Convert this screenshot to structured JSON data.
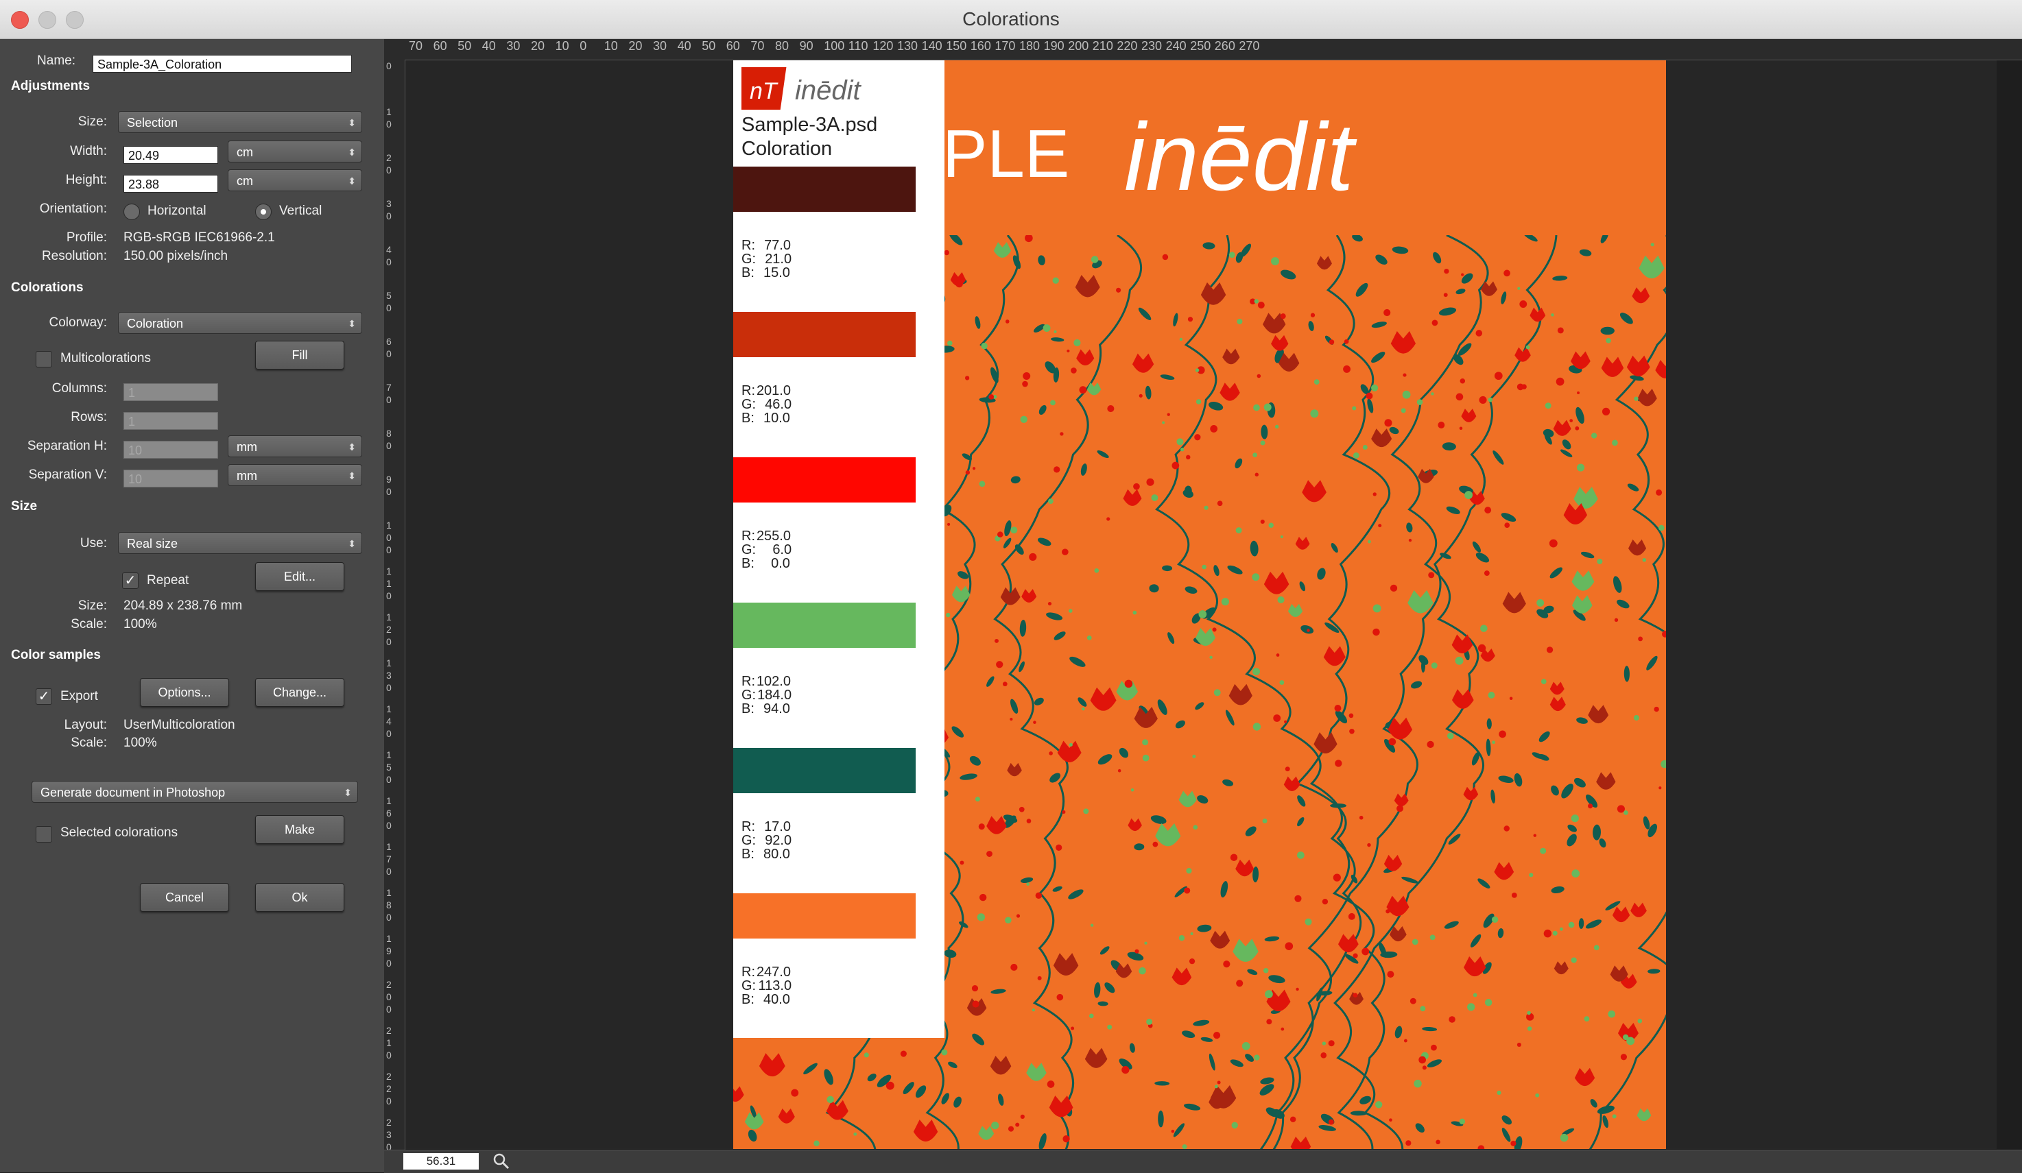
{
  "window": {
    "title": "Colorations"
  },
  "panel": {
    "name_label": "Name:",
    "name_value": "Sample-3A_Coloration",
    "adjustments_title": "Adjustments",
    "size_label": "Size:",
    "size_value": "Selection",
    "width_label": "Width:",
    "width_value": "20.49",
    "width_unit": "cm",
    "height_label": "Height:",
    "height_value": "23.88",
    "height_unit": "cm",
    "orientation_label": "Orientation:",
    "horizontal_label": "Horizontal",
    "vertical_label": "Vertical",
    "profile_label": "Profile:",
    "profile_value": "RGB-sRGB IEC61966-2.1",
    "resolution_label": "Resolution:",
    "resolution_value": "150.00 pixels/inch",
    "colorations_title": "Colorations",
    "colorway_label": "Colorway:",
    "colorway_value": "Coloration",
    "multicolorations_label": "Multicolorations",
    "fill_label": "Fill",
    "columns_label": "Columns:",
    "columns_value": "1",
    "rows_label": "Rows:",
    "rows_value": "1",
    "seph_label": "Separation H:",
    "seph_value": "10",
    "seph_unit": "mm",
    "sepv_label": "Separation V:",
    "sepv_value": "10",
    "sepv_unit": "mm",
    "size_section_title": "Size",
    "use_label": "Use:",
    "use_value": "Real size",
    "repeat_label": "Repeat",
    "edit_label": "Edit...",
    "size2_label": "Size:",
    "size2_value": "204.89 x 238.76 mm",
    "scale_label": "Scale:",
    "scale_value": "100%",
    "color_samples_title": "Color samples",
    "export_label": "Export",
    "options_label": "Options...",
    "change_label": "Change...",
    "layout_label": "Layout:",
    "layout_value": "UserMulticoloration",
    "scale2_label": "Scale:",
    "scale2_value": "100%",
    "generate_value": "Generate document in Photoshop",
    "selected_colorations_label": "Selected colorations",
    "make_label": "Make",
    "cancel_label": "Cancel",
    "ok_label": "Ok"
  },
  "ruler": {
    "h_labels": [
      "70",
      "60",
      "50",
      "40",
      "30",
      "20",
      "10",
      "0",
      "10",
      "20",
      "30",
      "40",
      "50",
      "60",
      "70",
      "80",
      "90",
      "100",
      "110",
      "120",
      "130",
      "140",
      "150",
      "160",
      "170",
      "180",
      "190",
      "200",
      "210",
      "220",
      "230",
      "240",
      "250",
      "260",
      "270"
    ],
    "v_labels": [
      "0",
      "10",
      "20",
      "30",
      "40",
      "50",
      "60",
      "70",
      "80",
      "90",
      "100",
      "110",
      "120",
      "130",
      "140",
      "150",
      "160",
      "170",
      "180",
      "190",
      "200",
      "210",
      "220",
      "230"
    ]
  },
  "document": {
    "brand": "inēdit",
    "logo_text": "nT",
    "big_brand": "inēdit",
    "ple_text": "PLE",
    "file_name": "Sample-3A.psd",
    "coloration_title": "Coloration",
    "swatches": [
      {
        "color": "#4d150f",
        "r": "77.0",
        "g": "21.0",
        "b": "15.0"
      },
      {
        "color": "#c92e0a",
        "r": "201.0",
        "g": "46.0",
        "b": "10.0"
      },
      {
        "color": "#ff0600",
        "r": "255.0",
        "g": "6.0",
        "b": "0.0"
      },
      {
        "color": "#66b85e",
        "r": "102.0",
        "g": "184.0",
        "b": "94.0"
      },
      {
        "color": "#115c50",
        "r": "17.0",
        "g": "92.0",
        "b": "80.0"
      },
      {
        "color": "#f77128",
        "r": "247.0",
        "g": "113.0",
        "b": "40.0"
      }
    ],
    "background_color": "#f07025"
  },
  "status": {
    "zoom_value": "56.31"
  }
}
